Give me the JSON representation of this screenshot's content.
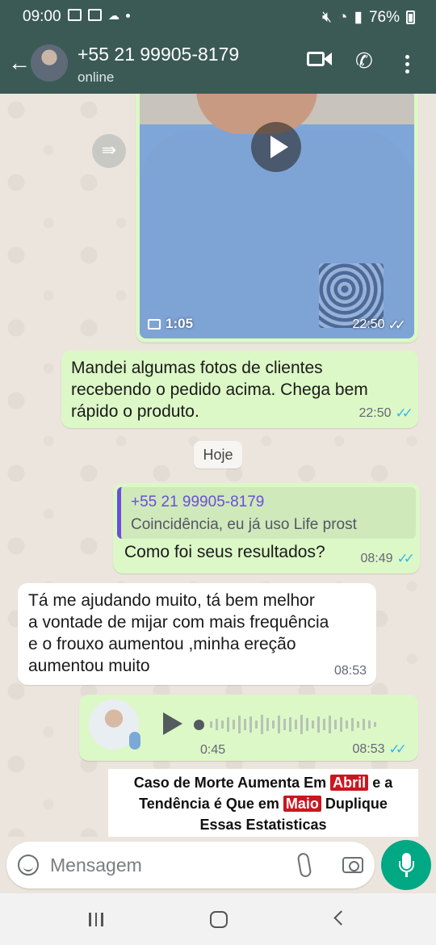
{
  "status_bar": {
    "time": "09:00",
    "battery": "76%"
  },
  "header": {
    "contact_name": "+55 21 99905-8179",
    "contact_status": "online"
  },
  "messages": {
    "video": {
      "duration": "1:05",
      "time": "22:50"
    },
    "text1": {
      "lines": [
        "Mandei algumas fotos de clientes",
        "recebendo o pedido acima. Chega bem",
        "rápido o produto."
      ],
      "time": "22:50"
    },
    "day_separator": "Hoje",
    "reply": {
      "quoted_name": "+55 21 99905-8179",
      "quoted_text": "Coincidência, eu já uso Life  prost",
      "text": "Como foi seus resultados?",
      "time": "08:49"
    },
    "incoming": {
      "lines": [
        "Tá  me ajudando muito, tá bem  melhor",
        "a  vontade de mijar com mais frequência",
        "e   o frouxo aumentou  ,minha ereção",
        "aumentou  muito"
      ],
      "time": "08:53"
    },
    "voice": {
      "duration": "0:45",
      "time": "08:53"
    }
  },
  "ad_banner": {
    "line1_before": "Caso de Morte Aumenta Em ",
    "line1_highlight": "Abril",
    "line1_after": " e a",
    "line2_before": "Tendência é Que em ",
    "line2_highlight": "Maio",
    "line2_after": " Duplique",
    "line3": "Essas Estatisticas"
  },
  "composer": {
    "placeholder": "Mensagem"
  },
  "colors": {
    "header": "#3b5a56",
    "outgoing_bubble": "#dcf8c6",
    "accent": "#00a884",
    "read_ticks": "#34b7f1",
    "quote_bar": "#6a4fd6"
  },
  "icons": [
    "back-arrow-icon",
    "video-call-icon",
    "phone-icon",
    "more-options-icon",
    "forward-icon",
    "play-icon",
    "emoji-icon",
    "attach-icon",
    "camera-icon",
    "mic-icon",
    "chevron-down-icon"
  ]
}
